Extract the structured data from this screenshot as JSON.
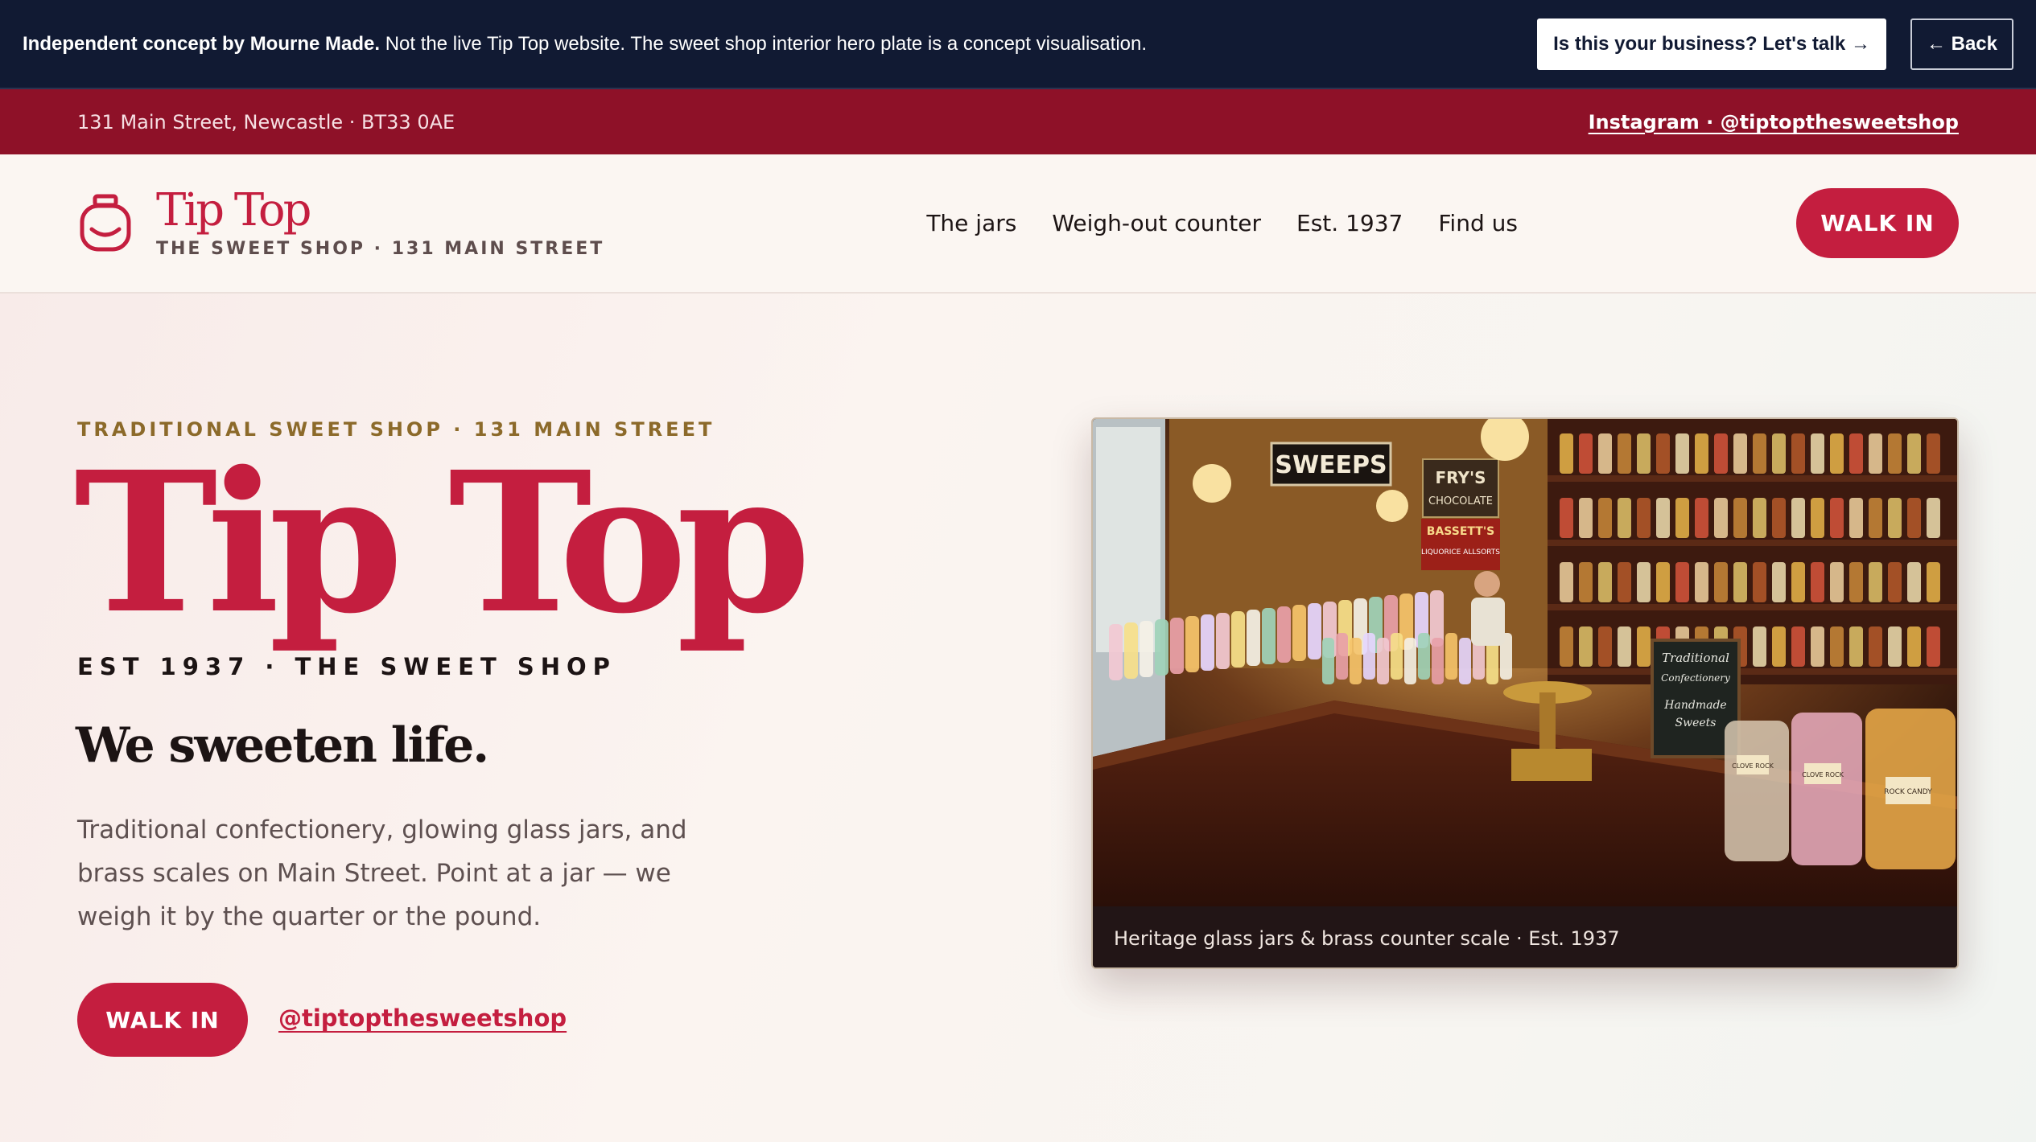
{
  "banner": {
    "bold_text": "Independent concept by Mourne Made.",
    "text": "Not the live Tip Top website. The sweet shop interior hero plate is a concept visualisation.",
    "talk_label": "Is this your business? Let's talk →",
    "back_label": "← Back"
  },
  "topbar": {
    "address": "131 Main Street, Newcastle · BT33 0AE",
    "instagram": "Instagram · @tiptopthesweetshop"
  },
  "header": {
    "brand_name": "Tip Top",
    "brand_sub": "THE SWEET SHOP · 131 MAIN STREET",
    "nav": [
      {
        "label": "The jars"
      },
      {
        "label": "Weigh-out counter"
      },
      {
        "label": "Est. 1937"
      },
      {
        "label": "Find us"
      }
    ],
    "cta": "WALK IN"
  },
  "hero": {
    "eyebrow": "TRADITIONAL SWEET SHOP · 131 MAIN STREET",
    "title": "Tip Top",
    "est_line": "EST 1937 · THE SWEET SHOP",
    "tagline": "We sweeten life.",
    "intro": "Traditional confectionery, glowing glass jars, and brass scales on Main Street. Point at a jar — we weigh it by the quarter or the pound.",
    "cta": "WALK IN",
    "handle": "@tiptopthesweetshop",
    "image_caption": "Heritage glass jars & brass counter scale · Est. 1937",
    "image_signs": [
      "SWEEPS",
      "FRY'S",
      "CHOCOLATE",
      "BASSETT'S",
      "LIQUORICE ALLSORTS",
      "Traditional",
      "Confectionery",
      "Handmade",
      "Sweets",
      "CLOVE ROCK",
      "CLOVE ROCK",
      "ROCK CANDY"
    ]
  },
  "colors": {
    "brand_red": "#c41e3f",
    "banner_navy": "#111a33",
    "address_bar": "#8e1128",
    "eyebrow_gold": "#8c6a2a"
  },
  "icons": {
    "brand": "sweet-jar-icon"
  }
}
